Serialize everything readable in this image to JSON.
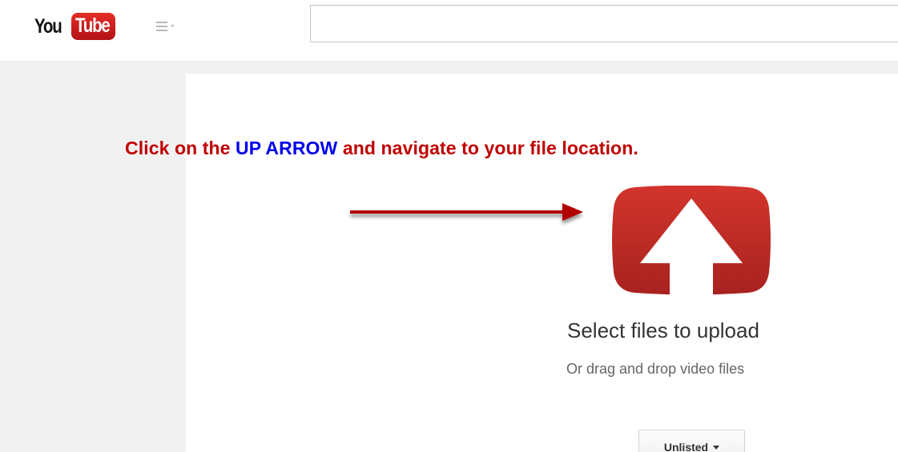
{
  "header": {
    "logo_you": "You",
    "logo_tube": "Tube",
    "search": {
      "value": "",
      "placeholder": ""
    }
  },
  "annotation": {
    "part1": "Click on the ",
    "highlight": "UP ARROW",
    "part2": " and navigate to your file location.",
    "text_color": "#c00000",
    "highlight_color": "#0000ee"
  },
  "upload": {
    "title": "Select files to upload",
    "subtitle": "Or drag and drop video files",
    "privacy_label": "Unlisted",
    "icon": "upload-arrow-icon",
    "brand_color": "#c4302b"
  }
}
